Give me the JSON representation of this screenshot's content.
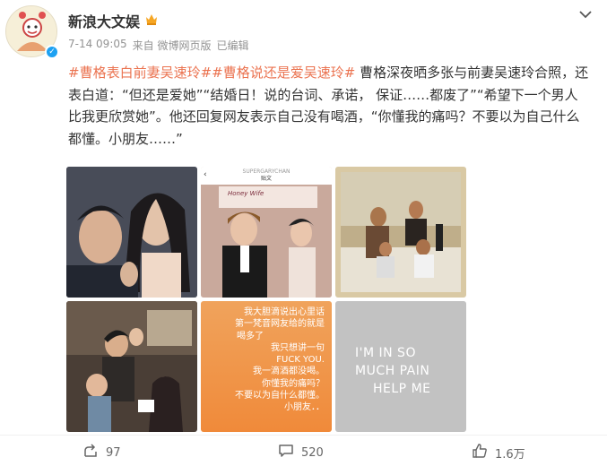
{
  "user": {
    "name": "新浪大文娱",
    "time": "7-14 09:05",
    "source": "来自 微博网页版",
    "edited": "已编辑"
  },
  "post": {
    "topic1": "#曹格表白前妻吴速玲#",
    "topic2": "#曹格说还是爱吴速玲#",
    "body": "曹格深夜晒多张与前妻吴速玲合照，还表白道：“但还是爱她”“结婚日！说的台词、承诺， 保证……都废了”“希望下一个男人比我更欣赏她”。他还回复网友表示自己没有喝酒，“你懂我的痛吗？不要以为自己什么都懂。小朋友……”"
  },
  "images": {
    "img2_header_small": "SUPERGARYCHAN",
    "img2_header_title": "贴文",
    "img2_sign": "Honey Wife",
    "img5_lines": [
      "我大胆滴说出心里话",
      "第一梵音网友给的就是",
      "喝多了",
      "我只想讲一句",
      "FUCK YOU.",
      "我一滴酒都没喝。",
      "你懂我的痛吗？",
      "不要以为自什么都懂。",
      "小朋友．．"
    ],
    "img6_lines": [
      "I'M IN SO",
      "MUCH PAIN",
      "HELP ME"
    ]
  },
  "actions": {
    "share_count": "97",
    "comment_count": "520",
    "like_count": "1.6万"
  },
  "colors": {
    "topic": "#eb7350",
    "meta": "#939393",
    "verified": "#1da1f2"
  },
  "icons": {
    "share": "share-icon",
    "comment": "comment-icon",
    "like": "like-icon",
    "more": "chevron-down-icon"
  }
}
